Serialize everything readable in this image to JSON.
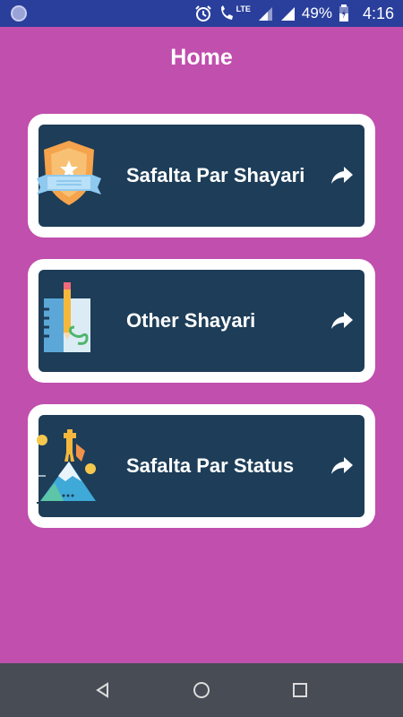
{
  "status_bar": {
    "network_label": "LTE",
    "battery": "49%",
    "time": "4:16",
    "icons": [
      "app-notification-icon",
      "alarm-icon",
      "phone-lte-icon",
      "signal-icon",
      "battery-icon"
    ]
  },
  "header": {
    "title": "Home"
  },
  "menu": [
    {
      "label": "Safalta Par Shayari",
      "icon": "shield-badge-icon"
    },
    {
      "label": "Other Shayari",
      "icon": "notebook-pencil-icon"
    },
    {
      "label": "Safalta Par Status",
      "icon": "mountain-success-icon"
    }
  ],
  "nav": {
    "buttons": [
      "back-icon",
      "home-icon",
      "recents-icon"
    ]
  },
  "colors": {
    "background": "#c04fad",
    "status_bar": "#2a3f9c",
    "card_border": "#ffffff",
    "card_fill": "#1d3d58",
    "nav_bar": "#474c55"
  }
}
